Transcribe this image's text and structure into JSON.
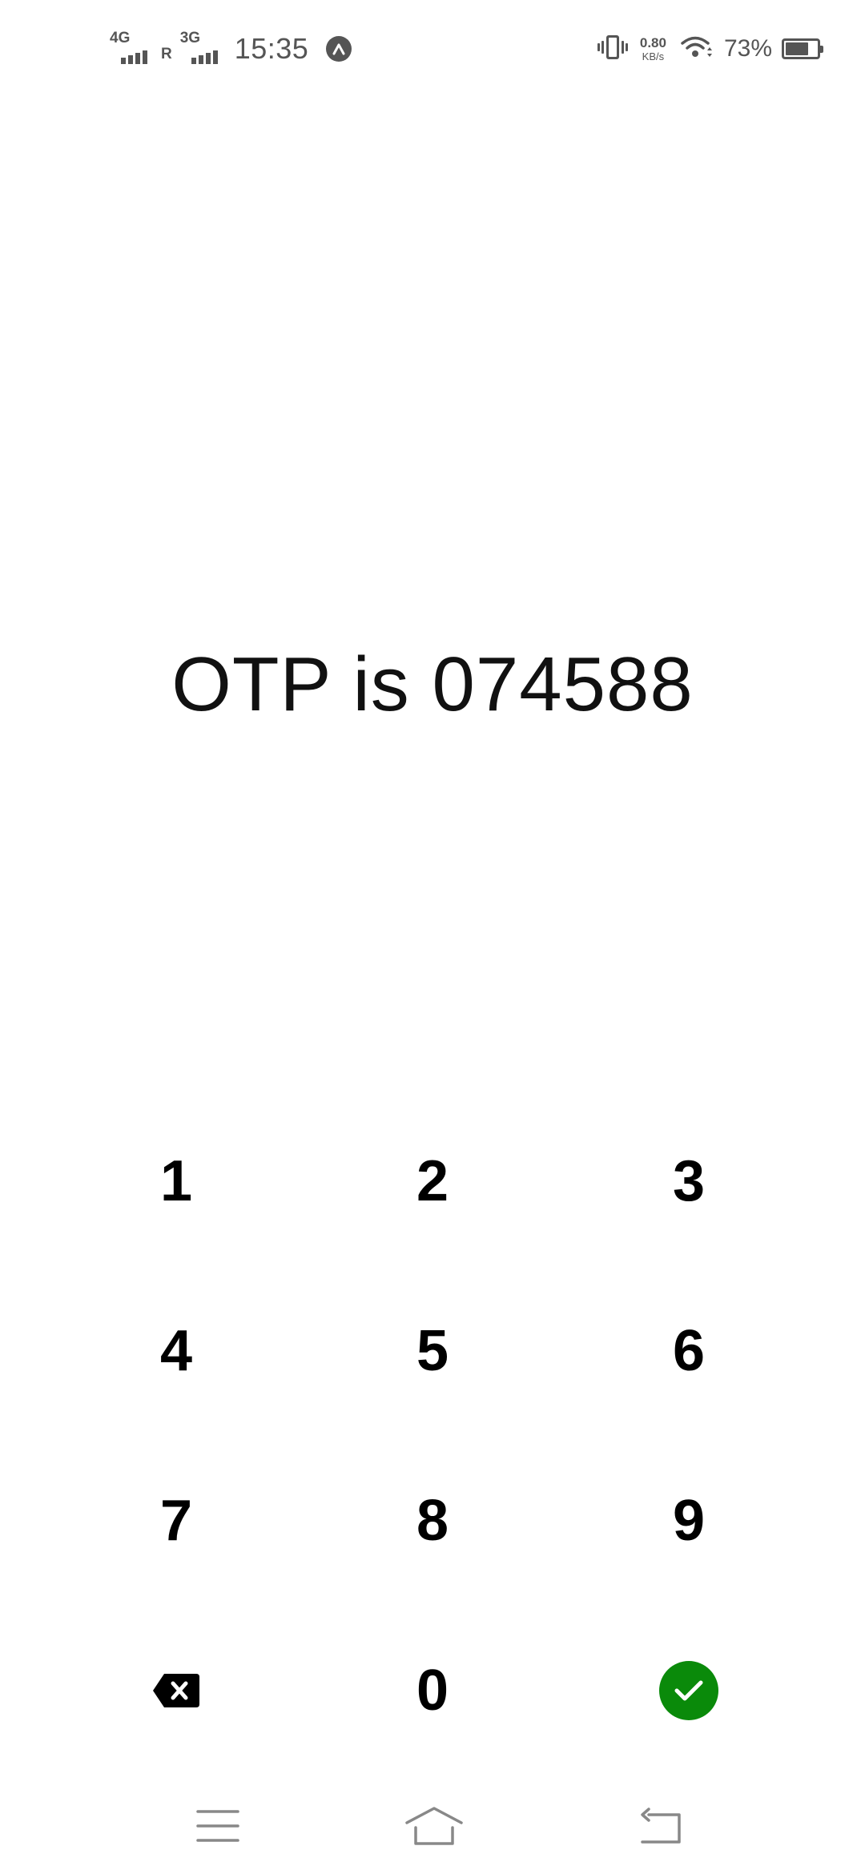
{
  "status_bar": {
    "sim1_network": "4G",
    "sim1_roaming": "R",
    "sim2_network": "3G",
    "time": "15:35",
    "speed_value": "0.80",
    "speed_unit": "KB/s",
    "battery_percent": "73%",
    "battery_level": 0.73,
    "icons": [
      "signal-icon",
      "app-notification-icon",
      "vibrate-icon",
      "wifi-icon",
      "battery-icon"
    ],
    "color": "#555555"
  },
  "message": {
    "otp_text": "OTP is 074588"
  },
  "keypad": {
    "keys": [
      "1",
      "2",
      "3",
      "4",
      "5",
      "6",
      "7",
      "8",
      "9",
      "0"
    ],
    "delete_icon": "backspace-icon",
    "confirm_icon": "checkmark-icon",
    "confirm_color": "#0a8a0a"
  },
  "nav_bar": {
    "icons": [
      "menu-icon",
      "home-icon",
      "back-icon"
    ],
    "color": "#888888"
  }
}
